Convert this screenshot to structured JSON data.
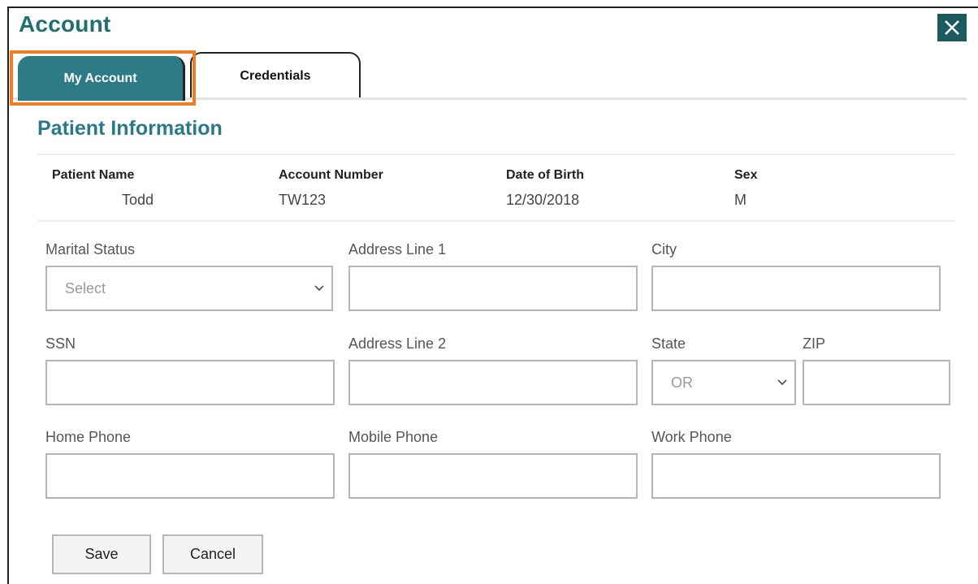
{
  "dialog": {
    "title": "Account",
    "close_icon": "close-icon"
  },
  "tabs": [
    {
      "label": "My Account",
      "active": true
    },
    {
      "label": "Credentials",
      "active": false
    }
  ],
  "highlight_color": "#f07d22",
  "section": {
    "title": "Patient Information"
  },
  "patient": {
    "name_label": "Patient Name",
    "name_value": "Todd",
    "account_label": "Account Number",
    "account_value": "TW123",
    "dob_label": "Date of Birth",
    "dob_value": "12/30/2018",
    "sex_label": "Sex",
    "sex_value": "M"
  },
  "form": {
    "marital_status": {
      "label": "Marital Status",
      "value": "Select"
    },
    "address1": {
      "label": "Address Line 1",
      "value": ""
    },
    "city": {
      "label": "City",
      "value": ""
    },
    "ssn": {
      "label": "SSN",
      "value": ""
    },
    "address2": {
      "label": "Address Line 2",
      "value": ""
    },
    "state": {
      "label": "State",
      "value": "OR"
    },
    "zip": {
      "label": "ZIP",
      "value": ""
    },
    "home_phone": {
      "label": "Home Phone",
      "value": ""
    },
    "mobile_phone": {
      "label": "Mobile Phone",
      "value": ""
    },
    "work_phone": {
      "label": "Work Phone",
      "value": ""
    }
  },
  "actions": {
    "save_label": "Save",
    "cancel_label": "Cancel"
  },
  "colors": {
    "accent": "#2d7b87",
    "title": "#1f6f73",
    "close_bg": "#1b5b5e"
  }
}
